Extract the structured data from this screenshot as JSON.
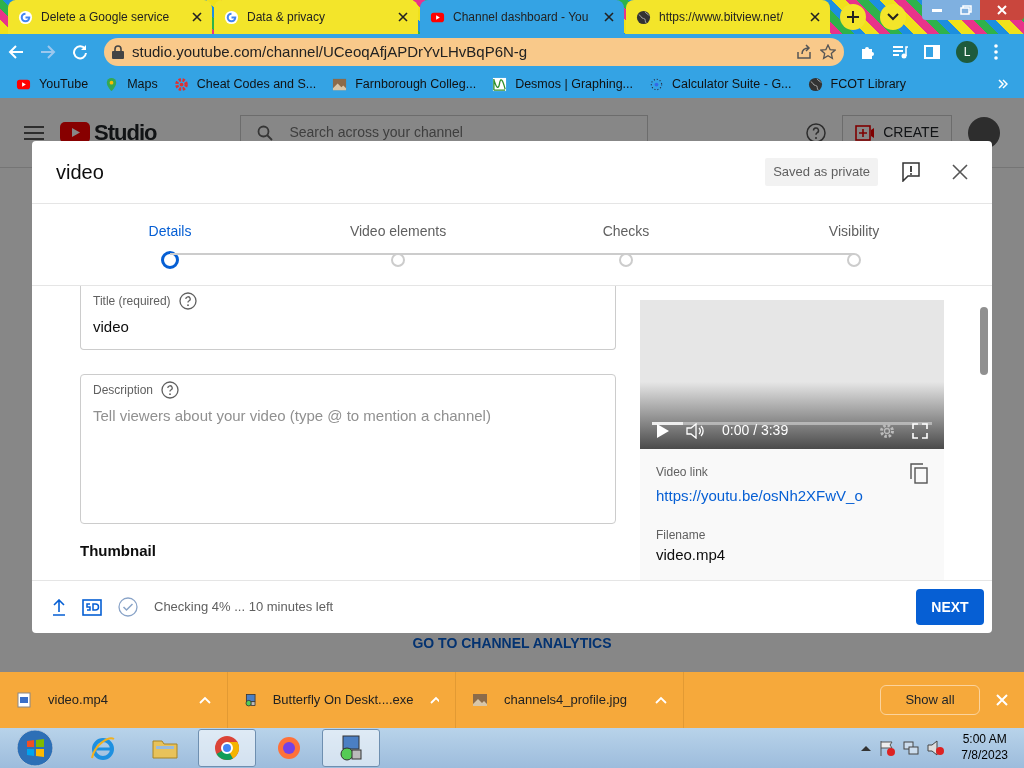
{
  "browser": {
    "tabs": [
      {
        "title": "Delete a Google service",
        "kind": "google",
        "selected": false
      },
      {
        "title": "Data & privacy",
        "kind": "google",
        "selected": false
      },
      {
        "title": "Channel dashboard - You",
        "kind": "youtube",
        "selected": true
      },
      {
        "title": "https://www.bitview.net/",
        "kind": "globe",
        "selected": false
      }
    ],
    "address": "studio.youtube.com/channel/UCeoqAfjAPDrYvLHvBqP6N-g",
    "profile_initial": "L",
    "bookmarks": [
      {
        "label": "YouTube",
        "kind": "youtube"
      },
      {
        "label": "Maps",
        "kind": "maps"
      },
      {
        "label": "Cheat Codes and S...",
        "kind": "gear"
      },
      {
        "label": "Farnborough Colleg...",
        "kind": "image"
      },
      {
        "label": "Desmos | Graphing...",
        "kind": "desmos"
      },
      {
        "label": "Calculator Suite - G...",
        "kind": "dots"
      },
      {
        "label": "FCOT Library",
        "kind": "globe"
      }
    ]
  },
  "studio": {
    "logo_text": "Studio",
    "search_placeholder": "Search across your channel",
    "create_label": "CREATE",
    "analytics_link": "GO TO CHANNEL ANALYTICS"
  },
  "dialog": {
    "title": "video",
    "save_status": "Saved as private",
    "steps": [
      {
        "label": "Details",
        "selected": true
      },
      {
        "label": "Video elements",
        "selected": false
      },
      {
        "label": "Checks",
        "selected": false
      },
      {
        "label": "Visibility",
        "selected": false
      }
    ],
    "title_field": {
      "label": "Title (required)",
      "value": "video"
    },
    "description_field": {
      "label": "Description",
      "placeholder": "Tell viewers about your video (type @ to mention a channel)"
    },
    "section_heading": "Thumbnail",
    "player": {
      "time": "0:00 / 3:39",
      "level": 0.11
    },
    "video_link_label": "Video link",
    "video_link": "https://youtu.be/osNh2XFwV_o",
    "filename_label": "Filename",
    "filename": "video.mp4",
    "status": "Checking 4% ... 10 minutes left",
    "next_label": "NEXT"
  },
  "downloads": {
    "items": [
      {
        "name": "video.mp4",
        "kind": "video"
      },
      {
        "name": "Butterfly On Deskt....exe",
        "kind": "installer"
      },
      {
        "name": "channels4_profile.jpg",
        "kind": "image"
      }
    ],
    "show_all": "Show all"
  },
  "taskbar": {
    "apps": [
      {
        "kind": "ie",
        "selected": false
      },
      {
        "kind": "explorer",
        "selected": false
      },
      {
        "kind": "chrome",
        "selected": true
      },
      {
        "kind": "firefox",
        "selected": false
      },
      {
        "kind": "installer",
        "selected": true
      }
    ],
    "time": "5:00 AM",
    "date": "7/8/2023"
  }
}
